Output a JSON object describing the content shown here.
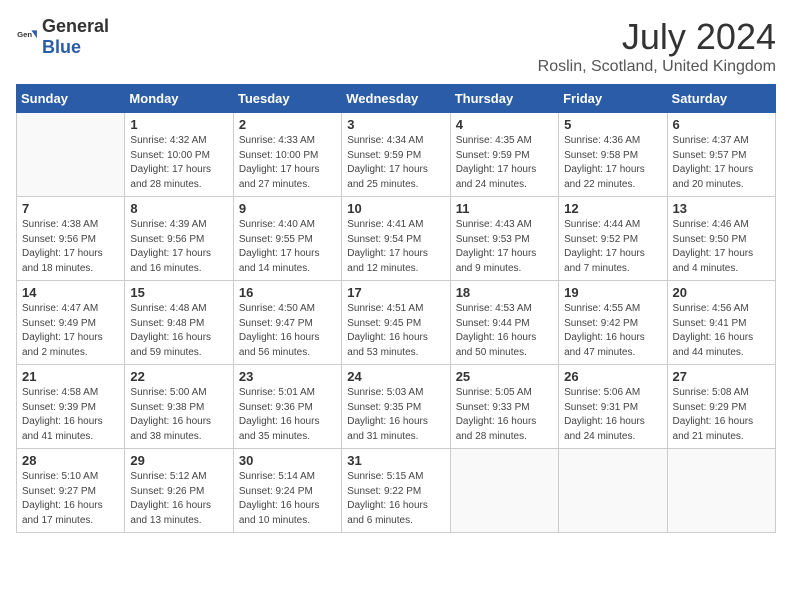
{
  "header": {
    "logo_general": "General",
    "logo_blue": "Blue",
    "month_title": "July 2024",
    "location": "Roslin, Scotland, United Kingdom"
  },
  "days_of_week": [
    "Sunday",
    "Monday",
    "Tuesday",
    "Wednesday",
    "Thursday",
    "Friday",
    "Saturday"
  ],
  "weeks": [
    [
      {
        "day": "",
        "info": ""
      },
      {
        "day": "1",
        "info": "Sunrise: 4:32 AM\nSunset: 10:00 PM\nDaylight: 17 hours and 28 minutes."
      },
      {
        "day": "2",
        "info": "Sunrise: 4:33 AM\nSunset: 10:00 PM\nDaylight: 17 hours and 27 minutes."
      },
      {
        "day": "3",
        "info": "Sunrise: 4:34 AM\nSunset: 9:59 PM\nDaylight: 17 hours and 25 minutes."
      },
      {
        "day": "4",
        "info": "Sunrise: 4:35 AM\nSunset: 9:59 PM\nDaylight: 17 hours and 24 minutes."
      },
      {
        "day": "5",
        "info": "Sunrise: 4:36 AM\nSunset: 9:58 PM\nDaylight: 17 hours and 22 minutes."
      },
      {
        "day": "6",
        "info": "Sunrise: 4:37 AM\nSunset: 9:57 PM\nDaylight: 17 hours and 20 minutes."
      }
    ],
    [
      {
        "day": "7",
        "info": "Sunrise: 4:38 AM\nSunset: 9:56 PM\nDaylight: 17 hours and 18 minutes."
      },
      {
        "day": "8",
        "info": "Sunrise: 4:39 AM\nSunset: 9:56 PM\nDaylight: 17 hours and 16 minutes."
      },
      {
        "day": "9",
        "info": "Sunrise: 4:40 AM\nSunset: 9:55 PM\nDaylight: 17 hours and 14 minutes."
      },
      {
        "day": "10",
        "info": "Sunrise: 4:41 AM\nSunset: 9:54 PM\nDaylight: 17 hours and 12 minutes."
      },
      {
        "day": "11",
        "info": "Sunrise: 4:43 AM\nSunset: 9:53 PM\nDaylight: 17 hours and 9 minutes."
      },
      {
        "day": "12",
        "info": "Sunrise: 4:44 AM\nSunset: 9:52 PM\nDaylight: 17 hours and 7 minutes."
      },
      {
        "day": "13",
        "info": "Sunrise: 4:46 AM\nSunset: 9:50 PM\nDaylight: 17 hours and 4 minutes."
      }
    ],
    [
      {
        "day": "14",
        "info": "Sunrise: 4:47 AM\nSunset: 9:49 PM\nDaylight: 17 hours and 2 minutes."
      },
      {
        "day": "15",
        "info": "Sunrise: 4:48 AM\nSunset: 9:48 PM\nDaylight: 16 hours and 59 minutes."
      },
      {
        "day": "16",
        "info": "Sunrise: 4:50 AM\nSunset: 9:47 PM\nDaylight: 16 hours and 56 minutes."
      },
      {
        "day": "17",
        "info": "Sunrise: 4:51 AM\nSunset: 9:45 PM\nDaylight: 16 hours and 53 minutes."
      },
      {
        "day": "18",
        "info": "Sunrise: 4:53 AM\nSunset: 9:44 PM\nDaylight: 16 hours and 50 minutes."
      },
      {
        "day": "19",
        "info": "Sunrise: 4:55 AM\nSunset: 9:42 PM\nDaylight: 16 hours and 47 minutes."
      },
      {
        "day": "20",
        "info": "Sunrise: 4:56 AM\nSunset: 9:41 PM\nDaylight: 16 hours and 44 minutes."
      }
    ],
    [
      {
        "day": "21",
        "info": "Sunrise: 4:58 AM\nSunset: 9:39 PM\nDaylight: 16 hours and 41 minutes."
      },
      {
        "day": "22",
        "info": "Sunrise: 5:00 AM\nSunset: 9:38 PM\nDaylight: 16 hours and 38 minutes."
      },
      {
        "day": "23",
        "info": "Sunrise: 5:01 AM\nSunset: 9:36 PM\nDaylight: 16 hours and 35 minutes."
      },
      {
        "day": "24",
        "info": "Sunrise: 5:03 AM\nSunset: 9:35 PM\nDaylight: 16 hours and 31 minutes."
      },
      {
        "day": "25",
        "info": "Sunrise: 5:05 AM\nSunset: 9:33 PM\nDaylight: 16 hours and 28 minutes."
      },
      {
        "day": "26",
        "info": "Sunrise: 5:06 AM\nSunset: 9:31 PM\nDaylight: 16 hours and 24 minutes."
      },
      {
        "day": "27",
        "info": "Sunrise: 5:08 AM\nSunset: 9:29 PM\nDaylight: 16 hours and 21 minutes."
      }
    ],
    [
      {
        "day": "28",
        "info": "Sunrise: 5:10 AM\nSunset: 9:27 PM\nDaylight: 16 hours and 17 minutes."
      },
      {
        "day": "29",
        "info": "Sunrise: 5:12 AM\nSunset: 9:26 PM\nDaylight: 16 hours and 13 minutes."
      },
      {
        "day": "30",
        "info": "Sunrise: 5:14 AM\nSunset: 9:24 PM\nDaylight: 16 hours and 10 minutes."
      },
      {
        "day": "31",
        "info": "Sunrise: 5:15 AM\nSunset: 9:22 PM\nDaylight: 16 hours and 6 minutes."
      },
      {
        "day": "",
        "info": ""
      },
      {
        "day": "",
        "info": ""
      },
      {
        "day": "",
        "info": ""
      }
    ]
  ]
}
